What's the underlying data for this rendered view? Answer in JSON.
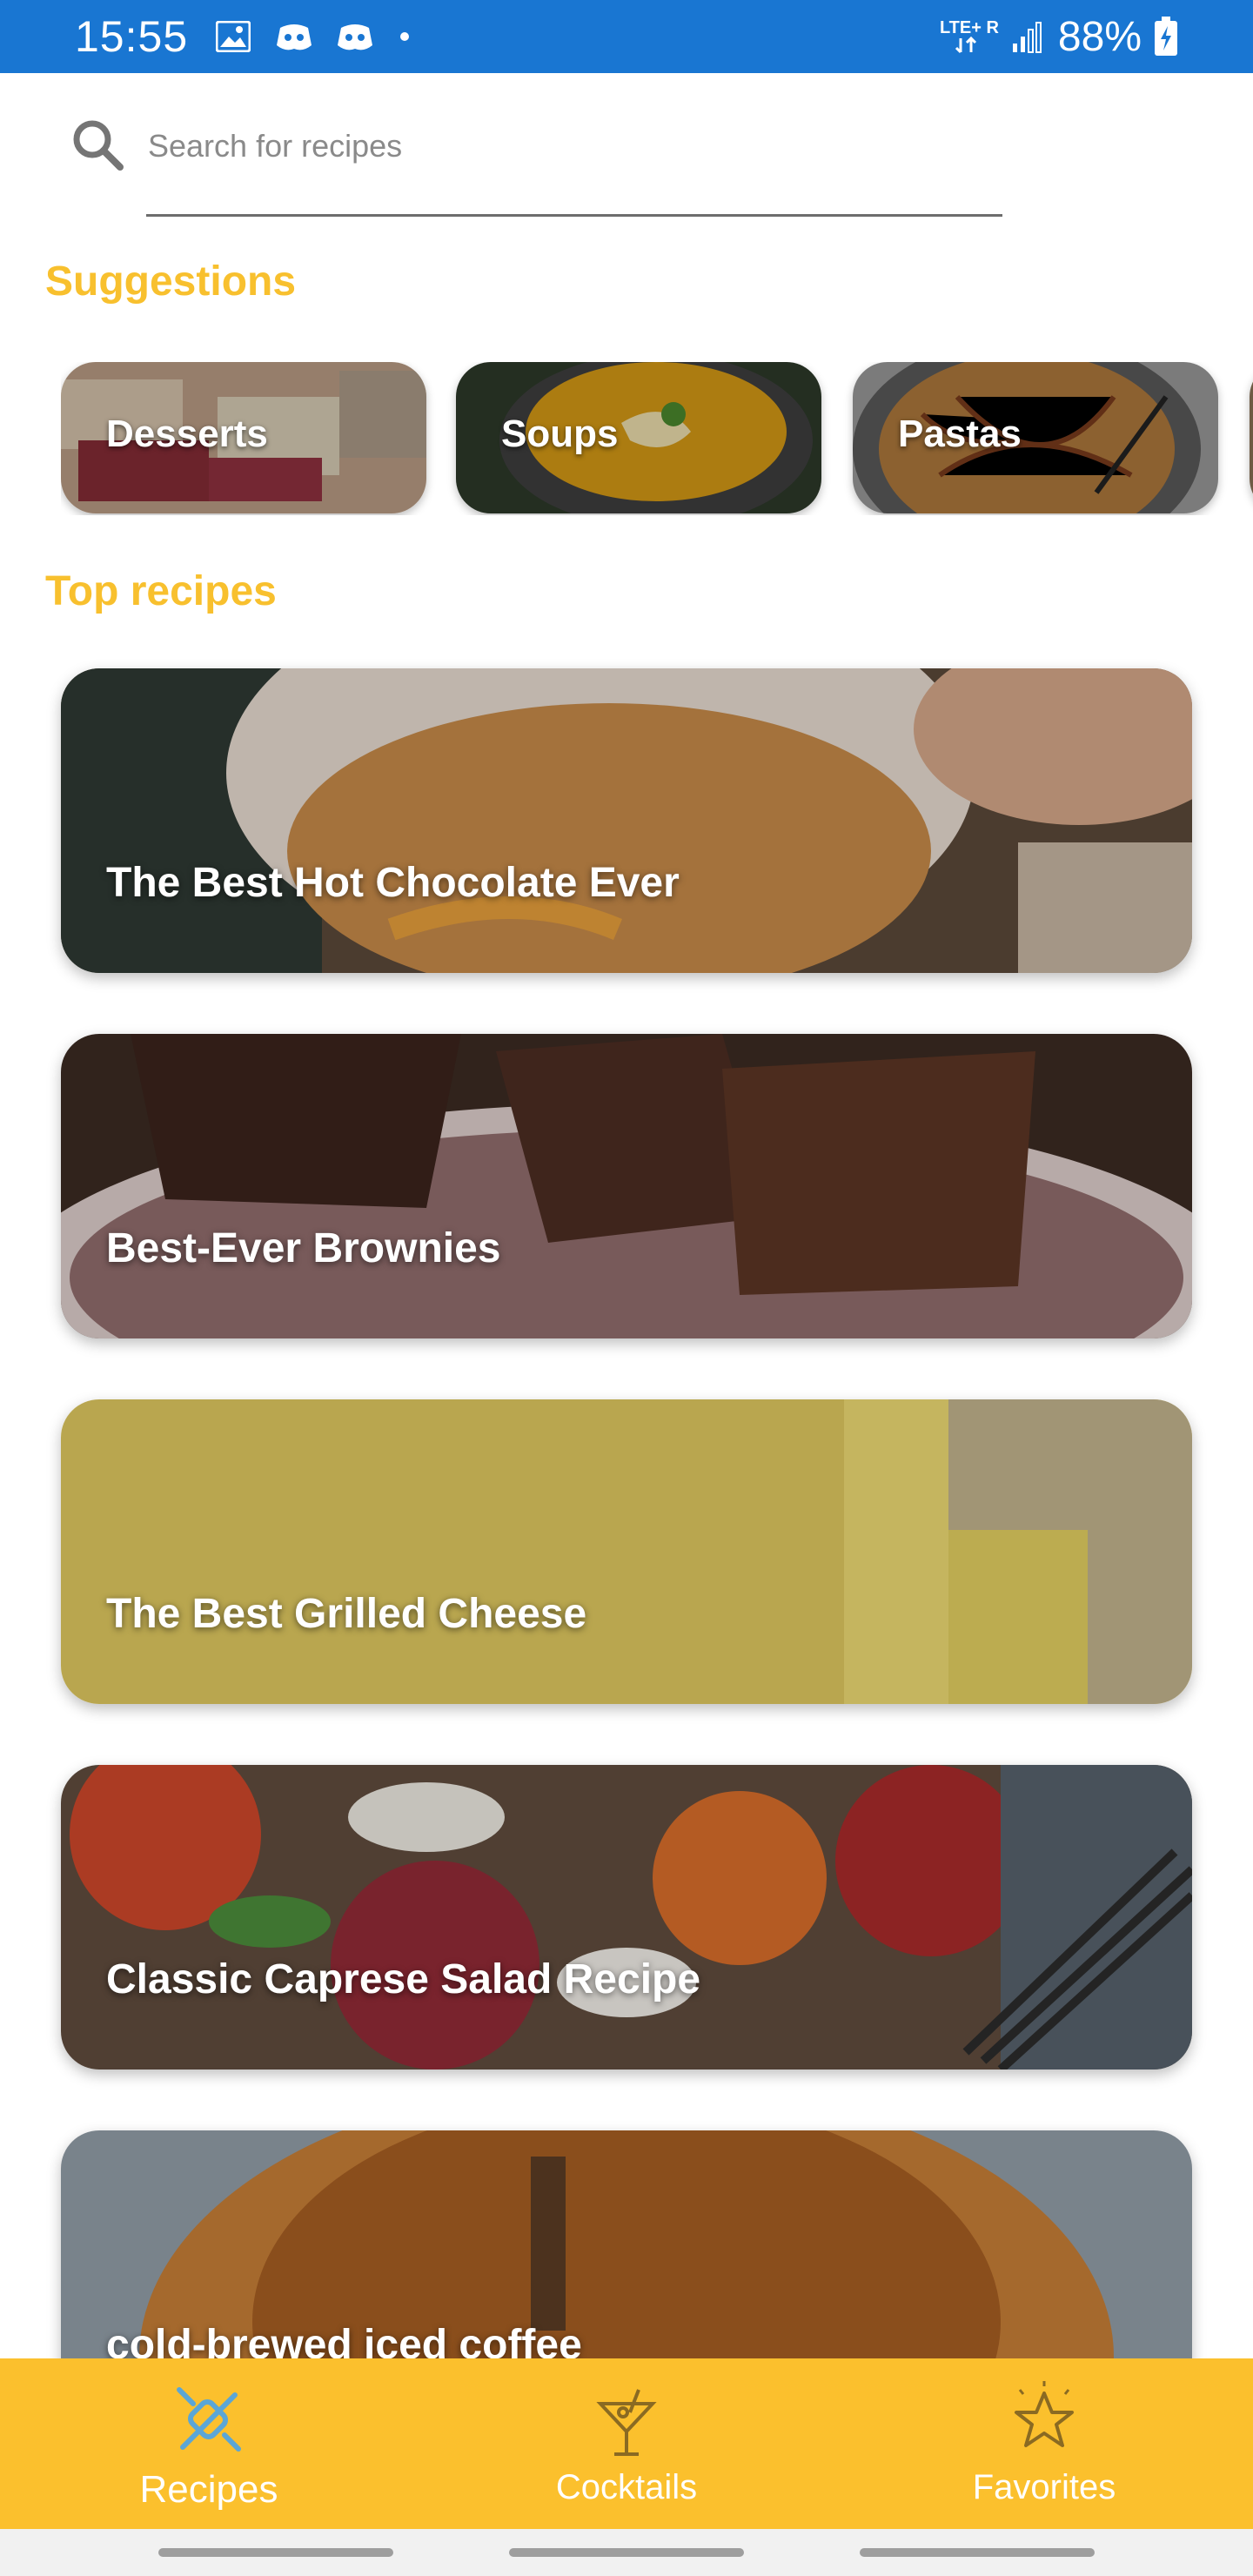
{
  "status_bar": {
    "time": "15:55",
    "network_top": "LTE+ R",
    "battery": "88%"
  },
  "search": {
    "placeholder": "Search for recipes"
  },
  "sections": {
    "suggestions_title": "Suggestions",
    "top_recipes_title": "Top recipes"
  },
  "suggestions": [
    {
      "label": "Desserts"
    },
    {
      "label": "Soups"
    },
    {
      "label": "Pastas"
    }
  ],
  "recipes": [
    {
      "title": "The Best Hot Chocolate Ever"
    },
    {
      "title": "Best-Ever Brownies"
    },
    {
      "title": "The Best Grilled Cheese"
    },
    {
      "title": "Classic Caprese Salad Recipe"
    },
    {
      "title": "cold-brewed iced coffee"
    }
  ],
  "bottom_nav": {
    "items": [
      {
        "label": "Recipes",
        "icon": "rolling-pin-icon",
        "active": true
      },
      {
        "label": "Cocktails",
        "icon": "cocktail-icon",
        "active": false
      },
      {
        "label": "Favorites",
        "icon": "star-icon",
        "active": false
      }
    ]
  },
  "colors": {
    "status_bar": "#1976d2",
    "accent_yellow": "#fbc02d",
    "section_title": "#f8c02e",
    "active_icon": "#5ba6d6"
  }
}
